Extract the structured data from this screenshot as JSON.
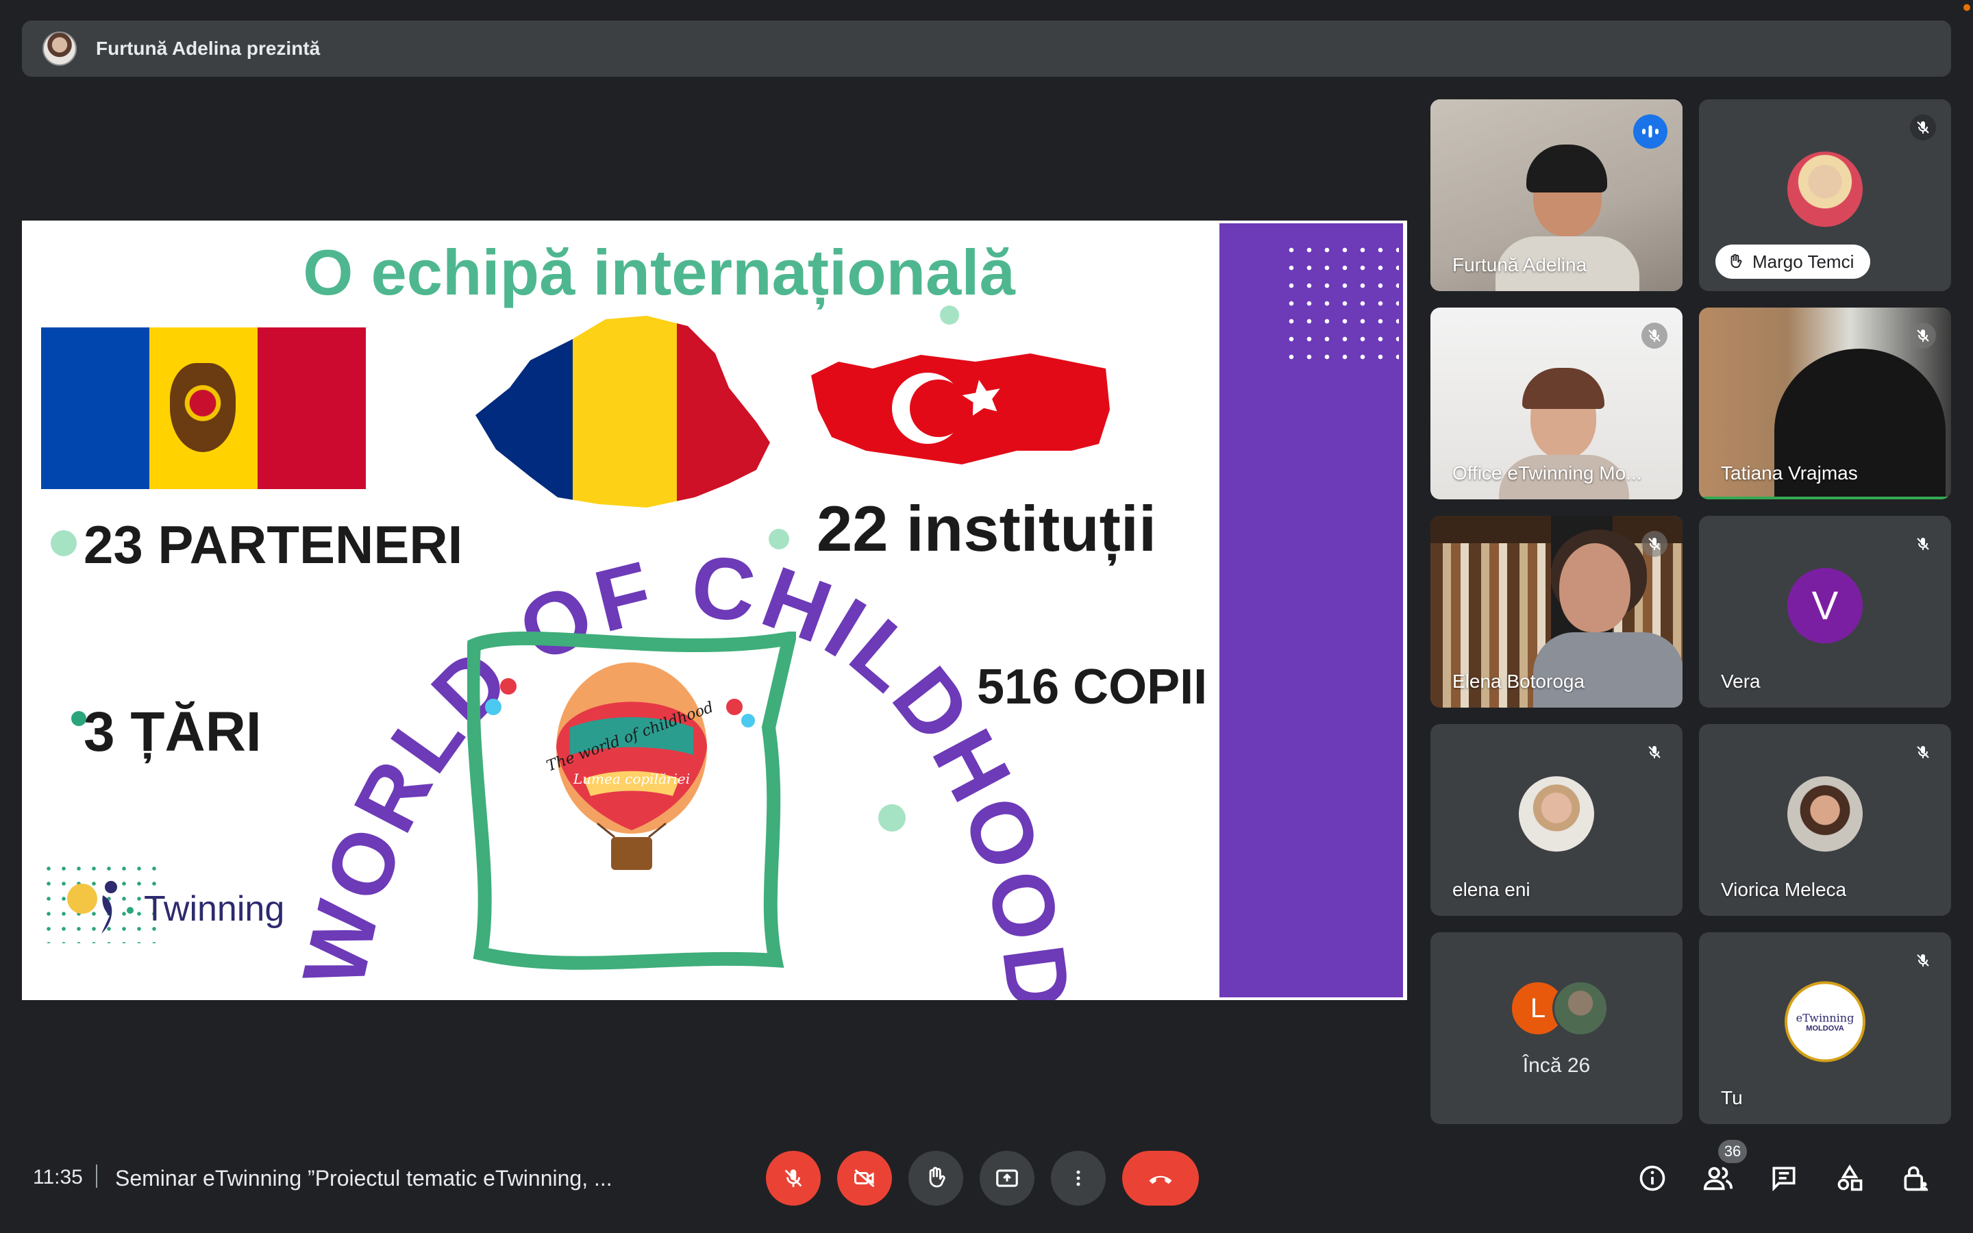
{
  "banner": {
    "text": "Furtună Adelina prezintă"
  },
  "slide": {
    "title": "O echipă internațională",
    "stat_partners": "23 PARTENERI",
    "stat_institutions": "22 instituții",
    "stat_children": "516 COPII",
    "stat_countries": "3 ȚĂRI",
    "arc_text": "THE WORLD OF CHILDHOOD",
    "etwinning_word": "Twinning",
    "balloon_line1": "The world of childhood",
    "balloon_line2": "Lumea copilăriei"
  },
  "participants": [
    {
      "name": "Furtună Adelina",
      "state": "speaking"
    },
    {
      "name": "Margo Temci",
      "state": "muted",
      "hand_raised": true
    },
    {
      "name": "Office eTwinning Mo...",
      "state": "muted"
    },
    {
      "name": "Tatiana Vrajmas",
      "state": "muted"
    },
    {
      "name": "Elena Botoroga",
      "state": "muted"
    },
    {
      "name": "Vera",
      "initial": "V",
      "state": "muted"
    },
    {
      "name": "elena eni",
      "state": "muted"
    },
    {
      "name": "Viorica Meleca",
      "state": "muted"
    },
    {
      "name": "Încă 26",
      "initial": "L"
    },
    {
      "name": "Tu",
      "state": "muted",
      "logo_line1": "eTwinning",
      "logo_line2": "MOLDOVA"
    }
  ],
  "bottom": {
    "time": "11:35",
    "meeting_title": "Seminar eTwinning ”Proiectul tematic eTwinning, ...",
    "people_count": "36"
  },
  "colors": {
    "accent": "#8ab4f8",
    "danger": "#ea4335",
    "tile": "#3c4043",
    "background": "#202124"
  }
}
